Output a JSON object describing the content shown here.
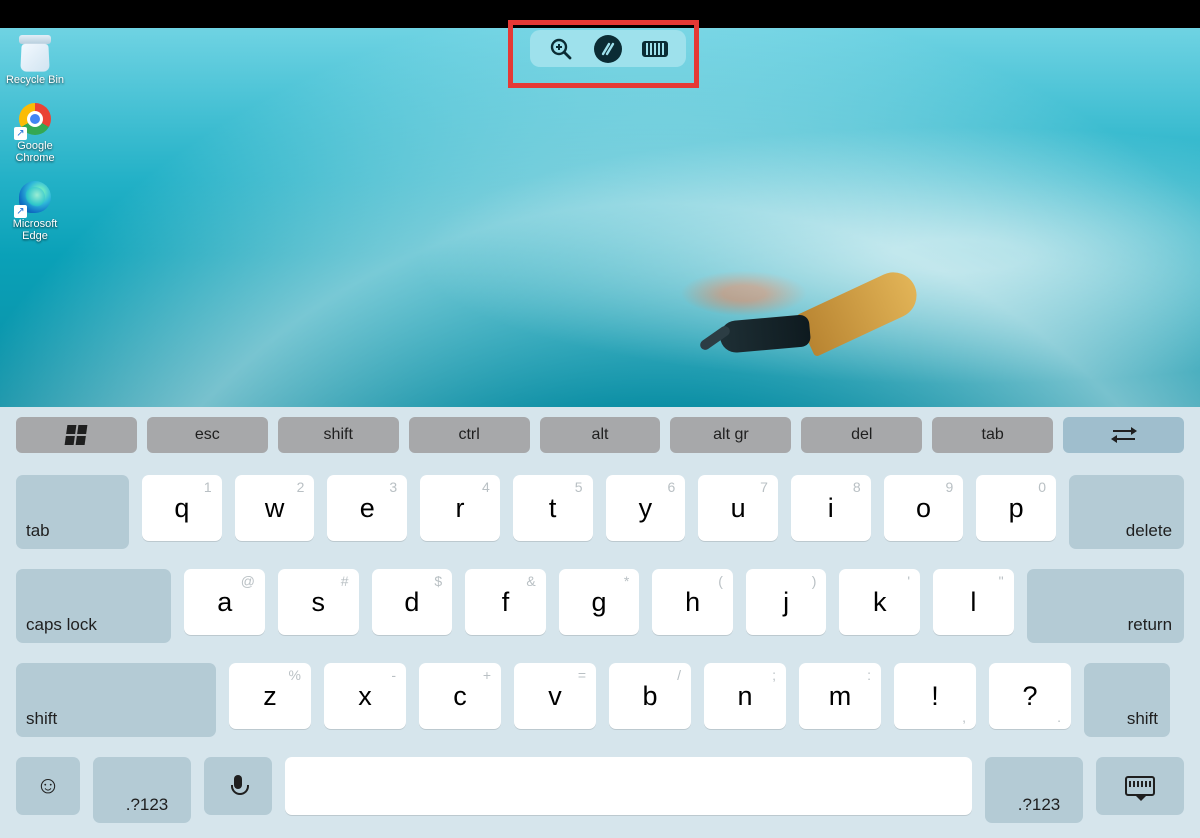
{
  "desktop_icons": [
    {
      "label": "Recycle Bin",
      "type": "bin"
    },
    {
      "label": "Google Chrome",
      "type": "chrome"
    },
    {
      "label": "Microsoft Edge",
      "type": "edge"
    }
  ],
  "remote_toolbar": {
    "zoom": "zoom",
    "connection": "connection",
    "keyboard": "keyboard"
  },
  "fn_row": [
    "",
    "esc",
    "shift",
    "ctrl",
    "alt",
    "alt gr",
    "del",
    "tab",
    ""
  ],
  "rows": {
    "r1": {
      "left": "tab",
      "keys": [
        [
          "q",
          "1"
        ],
        [
          "w",
          "2"
        ],
        [
          "e",
          "3"
        ],
        [
          "r",
          "4"
        ],
        [
          "t",
          "5"
        ],
        [
          "y",
          "6"
        ],
        [
          "u",
          "7"
        ],
        [
          "i",
          "8"
        ],
        [
          "o",
          "9"
        ],
        [
          "p",
          "0"
        ]
      ],
      "right": "delete"
    },
    "r2": {
      "left": "caps lock",
      "keys": [
        [
          "a",
          "@"
        ],
        [
          "s",
          "#"
        ],
        [
          "d",
          "$"
        ],
        [
          "f",
          "&"
        ],
        [
          "g",
          "*"
        ],
        [
          "h",
          "("
        ],
        [
          "j",
          ")"
        ],
        [
          "k",
          "'"
        ],
        [
          "l",
          "\""
        ]
      ],
      "right": "return"
    },
    "r3": {
      "left": "shift",
      "keys": [
        [
          "z",
          "%"
        ],
        [
          "x",
          "-"
        ],
        [
          "c",
          "+"
        ],
        [
          "v",
          "="
        ],
        [
          "b",
          "/"
        ],
        [
          "n",
          ";"
        ],
        [
          "m",
          ":"
        ],
        [
          "!",
          ","
        ],
        [
          "?",
          "."
        ]
      ],
      "right": "shift"
    },
    "r4": {
      "num_left": ".?123",
      "num_right": ".?123"
    }
  }
}
